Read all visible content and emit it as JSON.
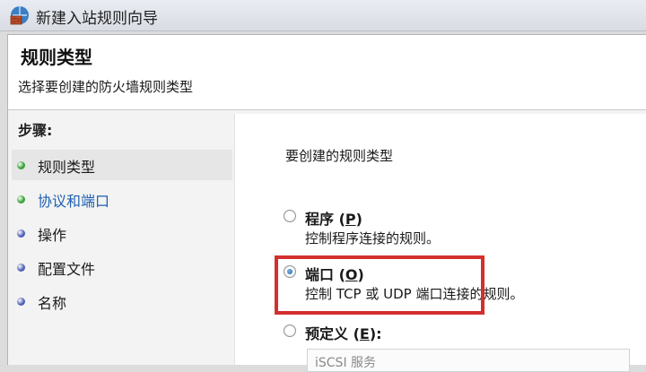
{
  "window": {
    "title": "新建入站规则向导"
  },
  "header": {
    "title": "规则类型",
    "subtitle": "选择要创建的防火墙规则类型"
  },
  "steps": {
    "title": "步骤:",
    "items": [
      {
        "label": "规则类型",
        "bullet_color": "#3aa33a"
      },
      {
        "label": "协议和端口",
        "bullet_color": "#3aa33a"
      },
      {
        "label": "操作",
        "bullet_color": "#5160b8"
      },
      {
        "label": "配置文件",
        "bullet_color": "#5160b8"
      },
      {
        "label": "名称",
        "bullet_color": "#5160b8"
      }
    ]
  },
  "content": {
    "prompt": "要创建的规则类型",
    "options": [
      {
        "label": "程序",
        "key": "P",
        "description": "控制程序连接的规则。",
        "selected": false
      },
      {
        "label": "端口",
        "key": "O",
        "description": "控制 TCP 或 UDP 端口连接的规则。",
        "selected": true
      },
      {
        "label": "预定义",
        "key": "E",
        "description": "",
        "selected": false
      }
    ],
    "predefined_value": "iSCSI 服务"
  },
  "colors": {
    "highlight": "#d32f2f",
    "link_step": "#1e5fb0"
  }
}
